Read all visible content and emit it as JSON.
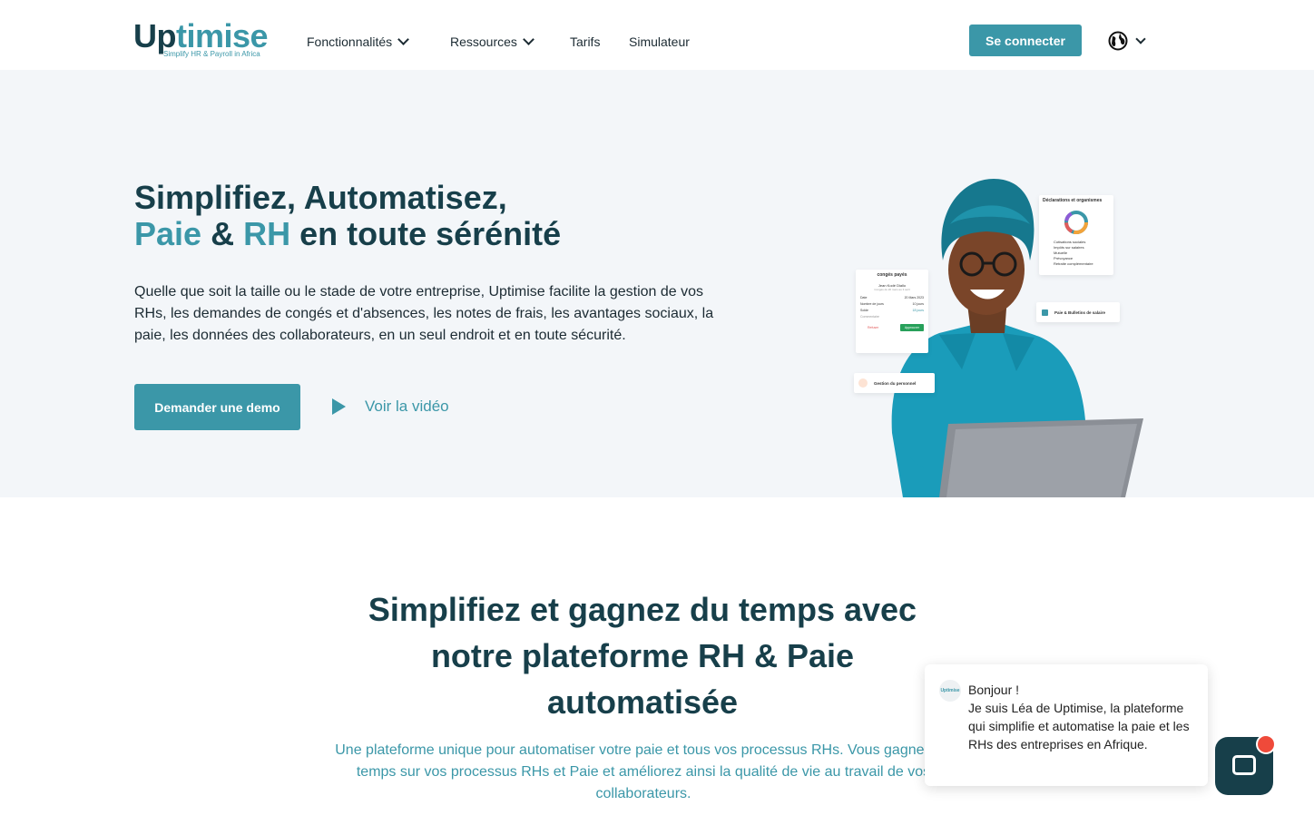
{
  "header": {
    "logo_main_a": "Up",
    "logo_main_b": "timise",
    "logo_tagline": "Simplify HR & Payroll in Africa",
    "nav": [
      {
        "label": "Fonctionnalités",
        "has_dropdown": true
      },
      {
        "label": "Ressources",
        "has_dropdown": true
      },
      {
        "label": "Tarifs",
        "has_dropdown": false
      },
      {
        "label": "Simulateur",
        "has_dropdown": false
      }
    ],
    "login_label": "Se connecter",
    "language_icon": "globe-icon"
  },
  "hero": {
    "title_line1": "Simplifiez, Automatisez,",
    "title_word1": "Paie",
    "title_amp": "&",
    "title_word2": "RH",
    "title_rest": "en toute sérénité",
    "description": "Quelle que soit la taille ou le stade de votre entreprise, Uptimise facilite la gestion de vos RHs, les demandes de congés et d'absences, les notes de frais, les avantages sociaux, la paie, les données des collaborateurs, en un seul endroit et en toute sécurité.",
    "demo_label": "Demander une demo",
    "video_label": "Voir la vidéo",
    "cards": {
      "declarations_title": "Déclarations et organismes",
      "declarations_items": [
        "Cotisations sociales",
        "Impôts sur salaires",
        "Mutuelle",
        "Prévoyance",
        "Retraite complémentaire"
      ],
      "leave_title": "congés payés",
      "leave_person": "Jean Kodé Diallo",
      "leave_subtitle": "Congés du 20 mars au 3 avril",
      "leave_rows": [
        {
          "k": "Date",
          "v": "20 Mars 2023"
        },
        {
          "k": "Nombre de jours",
          "v": "10 jours"
        },
        {
          "k": "Solde",
          "v": "18 jours"
        }
      ],
      "leave_comment": "Commentaire",
      "leave_refuse": "Refuser",
      "leave_approve": "Approuver",
      "payroll_label": "Paie & Bulletins de salaire",
      "staff_label": "Gestion du personnel"
    }
  },
  "section2": {
    "title_line1": "Simplifiez et gagnez du temps avec",
    "title_line2": "notre plateforme RH & Paie",
    "title_line3": "automatisée",
    "subtitle": "Une plateforme unique pour automatiser votre paie et tous vos processus RHs. Vous gagnez du temps sur vos processus RHs et Paie et améliorez ainsi la qualité de vie au travail de vos collaborateurs."
  },
  "chat": {
    "avatar_text": "Uptimise",
    "greeting": "Bonjour !",
    "message": "Je suis Léa de Uptimise, la plateforme qui simplifie et automatise la paie et les RHs des entreprises en Afrique.",
    "button_icon": "chat-icon"
  },
  "colors": {
    "brand_teal": "#3b97a8",
    "brand_dark": "#173f4a",
    "hero_bg": "#f3f6f9",
    "notification": "#ef4a3a"
  }
}
